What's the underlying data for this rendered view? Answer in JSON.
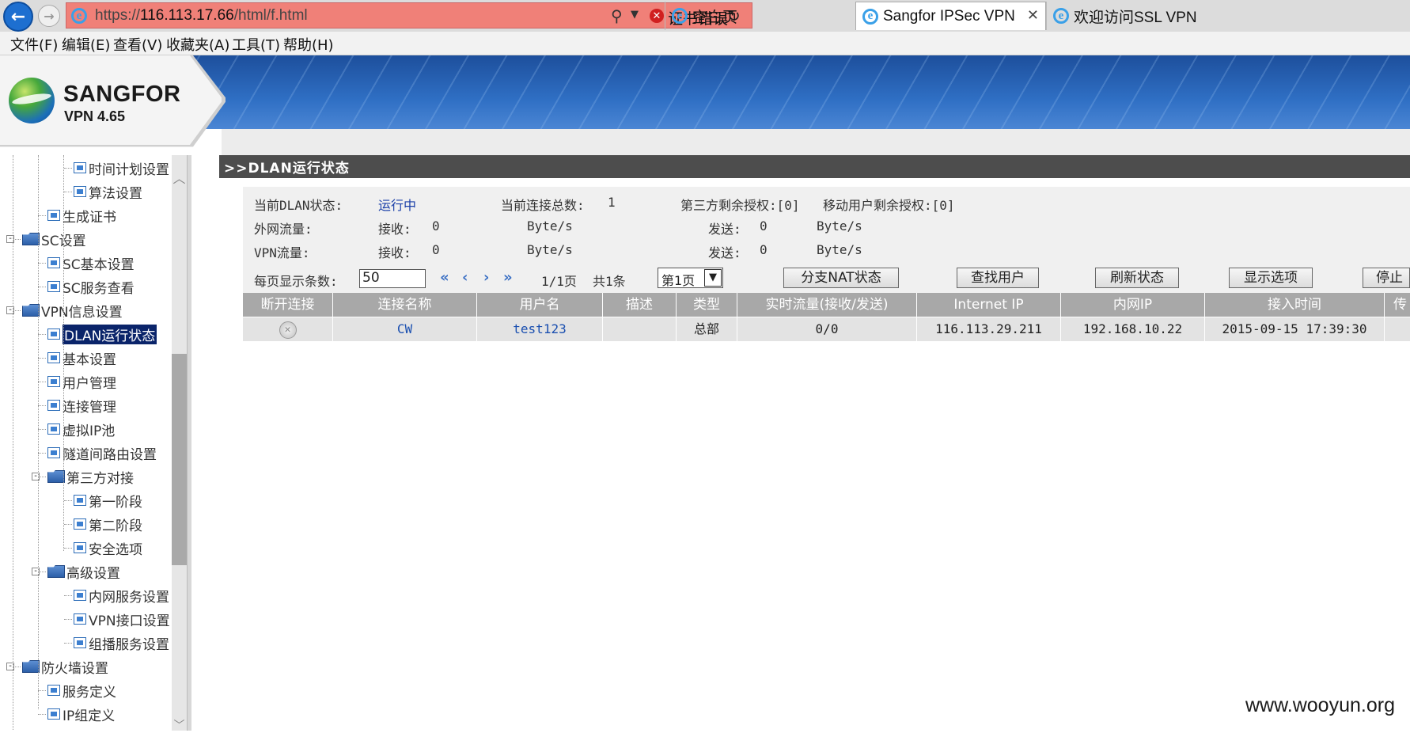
{
  "browser": {
    "address": {
      "scheme": "https://",
      "host": "116.113.17.66",
      "path": "/html/f.html",
      "cert_error": "证书错误"
    },
    "tabs": [
      {
        "label": "空白页"
      },
      {
        "label": "Sangfor IPSec VPN"
      },
      {
        "label": "欢迎访问SSL VPN"
      }
    ],
    "menu": [
      "文件(F)",
      "编辑(E)",
      "查看(V)",
      "收藏夹(A)",
      "工具(T)",
      "帮助(H)"
    ]
  },
  "logo": {
    "title": "SANGFOR",
    "subtitle": "VPN 4.65"
  },
  "sidebar": {
    "items": [
      {
        "label": "时间计划设置",
        "type": "doc",
        "level": 3
      },
      {
        "label": "算法设置",
        "type": "doc",
        "level": 3
      },
      {
        "label": "生成证书",
        "type": "doc",
        "level": 2
      },
      {
        "label": "SC设置",
        "type": "folder",
        "level": 1
      },
      {
        "label": "SC基本设置",
        "type": "doc",
        "level": 2
      },
      {
        "label": "SC服务查看",
        "type": "doc",
        "level": 2
      },
      {
        "label": "VPN信息设置",
        "type": "folder",
        "level": 1
      },
      {
        "label": "DLAN运行状态",
        "type": "doc",
        "level": 2,
        "selected": true
      },
      {
        "label": "基本设置",
        "type": "doc",
        "level": 2
      },
      {
        "label": "用户管理",
        "type": "doc",
        "level": 2
      },
      {
        "label": "连接管理",
        "type": "doc",
        "level": 2
      },
      {
        "label": "虚拟IP池",
        "type": "doc",
        "level": 2
      },
      {
        "label": "隧道间路由设置",
        "type": "doc",
        "level": 2
      },
      {
        "label": "第三方对接",
        "type": "folder",
        "level": 2
      },
      {
        "label": "第一阶段",
        "type": "doc",
        "level": 3
      },
      {
        "label": "第二阶段",
        "type": "doc",
        "level": 3
      },
      {
        "label": "安全选项",
        "type": "doc",
        "level": 3
      },
      {
        "label": "高级设置",
        "type": "folder",
        "level": 2
      },
      {
        "label": "内网服务设置",
        "type": "doc",
        "level": 3
      },
      {
        "label": "VPN接口设置",
        "type": "doc",
        "level": 3
      },
      {
        "label": "组播服务设置",
        "type": "doc",
        "level": 3
      },
      {
        "label": "防火墙设置",
        "type": "folder",
        "level": 1
      },
      {
        "label": "服务定义",
        "type": "doc",
        "level": 2
      },
      {
        "label": "IP组定义",
        "type": "doc",
        "level": 2
      }
    ],
    "expander": "-"
  },
  "main": {
    "title": ">>DLAN运行状态",
    "status": {
      "dlan_label": "当前DLAN状态:",
      "dlan_value": "运行中",
      "conn_label": "当前连接总数:",
      "conn_value": "1",
      "third_party": "第三方剩余授权:[0]",
      "mobile": "移动用户剩余授权:[0]",
      "wan_label": "外网流量:",
      "vpn_label": "VPN流量:",
      "recv_label": "接收:",
      "send_label": "发送:",
      "wan_recv": "0",
      "wan_send": "0",
      "vpn_recv": "0",
      "vpn_send": "0",
      "unit": "Byte/s"
    },
    "pagination": {
      "per_page_label": "每页显示条数:",
      "per_page_value": "50",
      "first": "«",
      "prev": "‹",
      "next": "›",
      "last": "»",
      "page_info": "1/1页",
      "total": "共1条",
      "page_select": "第1页"
    },
    "buttons": {
      "nat": "分支NAT状态",
      "find_user": "查找用户",
      "refresh": "刷新状态",
      "options": "显示选项",
      "stop": "停止服"
    },
    "table": {
      "headers": [
        "断开连接",
        "连接名称",
        "用户名",
        "描述",
        "类型",
        "实时流量(接收/发送)",
        "Internet IP",
        "内网IP",
        "接入时间",
        "传"
      ],
      "rows": [
        {
          "disconnect_icon": "✕",
          "name": "CW",
          "user": "test123",
          "desc": "",
          "type": "总部",
          "traffic": "0/0",
          "internet_ip": "116.113.29.211",
          "lan_ip": "192.168.10.22",
          "time": "2015-09-15 17:39:30",
          "extra": ""
        }
      ]
    }
  },
  "watermark": "www.wooyun.org",
  "colors": {
    "address_bar": "#f08078",
    "title_bar": "#4d4d4d",
    "table_header": "#a8a8a8",
    "selected_tree": "#0a246a"
  }
}
